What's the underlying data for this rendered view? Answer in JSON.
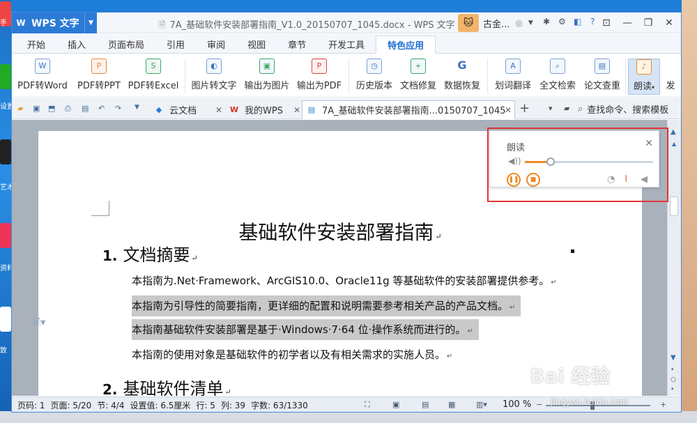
{
  "desktop": {
    "labels": [
      "手",
      "设置",
      "艺术",
      "资料",
      "致"
    ]
  },
  "titlebar": {
    "app_name": "WPS 文字",
    "document_title": "7A_基础软件安装部署指南_V1.0_20150707_1045.docx - WPS 文字",
    "user_name": "古金..."
  },
  "menu_tabs": [
    "开始",
    "插入",
    "页面布局",
    "引用",
    "审阅",
    "视图",
    "章节",
    "开发工具",
    "特色应用"
  ],
  "active_menu_tab": "特色应用",
  "ribbon": {
    "buttons": [
      {
        "label": "PDF转Word",
        "icon": "word-icon"
      },
      {
        "label": "PDF转PPT",
        "icon": "ppt-icon"
      },
      {
        "label": "PDF转Excel",
        "icon": "excel-icon"
      },
      {
        "label": "图片转文字",
        "icon": "ocr-icon"
      },
      {
        "label": "输出为图片",
        "icon": "export-image-icon"
      },
      {
        "label": "输出为PDF",
        "icon": "export-pdf-icon"
      },
      {
        "label": "历史版本",
        "icon": "history-icon"
      },
      {
        "label": "文档修复",
        "icon": "repair-icon"
      },
      {
        "label": "数据恢复",
        "icon": "recovery-icon"
      },
      {
        "label": "划词翻译",
        "icon": "translate-icon"
      },
      {
        "label": "全文检索",
        "icon": "fulltext-search-icon"
      },
      {
        "label": "论文查重",
        "icon": "plagiarism-check-icon"
      },
      {
        "label": "朗读",
        "icon": "microphone-icon"
      },
      {
        "label": "发",
        "icon": "send-icon"
      }
    ]
  },
  "doc_tabs": [
    {
      "label": "云文档"
    },
    {
      "label": "我的WPS"
    },
    {
      "label": "7A_基础软件安装部署指南...0150707_1045"
    }
  ],
  "search_command": "查找命令、搜索模板",
  "document": {
    "heading": "基础软件安装部署指南",
    "sections": [
      {
        "number": "1.",
        "title": "文档摘要"
      },
      {
        "number": "2.",
        "title": "基础软件清单"
      }
    ],
    "paragraphs": [
      {
        "text": "本指南为.Net·Framework、ArcGIS10.0、Oracle11g 等基础软件的安装部署提供参考。",
        "highlighted": false
      },
      {
        "text": "本指南为引导性的简要指南，更详细的配置和说明需要参考相关产品的产品文档。",
        "highlighted": true
      },
      {
        "text": "本指南基础软件安装部署是基于·Windows·7·64 位·操作系统而进行的。",
        "highlighted": true
      },
      {
        "text": "本指南的使用对象是基础软件的初学者以及有相关需求的实施人员。",
        "highlighted": false
      }
    ]
  },
  "read_aloud": {
    "title": "朗读",
    "volume_fraction": 0.2,
    "volume_color": "#f08a24"
  },
  "status": {
    "page_code": "页码: 1",
    "page": "页面: 5/20",
    "section": "节: 4/4",
    "setting": "设置值: 6.5厘米",
    "row": "行: 5",
    "column": "列: 39",
    "word_count": "字数: 63/1330",
    "zoom": "100 %"
  },
  "watermark": {
    "text": "Bai 经验",
    "url": "jingyan.baidu.com"
  },
  "colors": {
    "accent": "#2b7bd6",
    "highlight_outline": "#e03535",
    "selection": "#c9c9c9"
  }
}
